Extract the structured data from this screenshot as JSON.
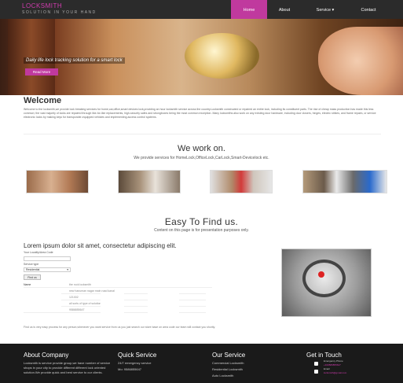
{
  "header": {
    "logo": "LOCKSMITH",
    "tagline": "SOLUTION IN YOUR HAND",
    "menu": [
      "Home",
      "About",
      "Service ▾",
      "Contact"
    ]
  },
  "hero": {
    "caption": "Daily life lock tracking solution for a smart lock",
    "button": "Read More"
  },
  "welcome": {
    "title": "Welcome",
    "text": "Welcome to the locksmith,we provide lock breaking services for home,car,office,smart devices lock,providing an hour locksmith service across the country.Locksmith constructed or repaired an entire lock, including its constituent parts. The rise of cheap mass production has made this less common; the vast majority of locks are repaired through like-for-like replacements, high-security safes and strongboxes being the most common exception. Many locksmiths also work on any existing door hardware, including door closers, hinges, electric strikes, and frame repairs, or service electronic locks by making keys for transponder-equipped vehicles and implementing access control systems."
  },
  "work": {
    "title": "We work on.",
    "subtitle": "We provide services for HomeLock,OfficeLock,CarLock,Smart-Devicelock etc."
  },
  "find": {
    "title": "Easy To Find us.",
    "subtitle": "Content on this page is for presentation purposes only.",
    "heading": "Lorem ipsum dolor sit amet, consectetur adipiscing elit.",
    "area_label": "Your Locality/Area Code",
    "service_label": "Service type",
    "service_value": "Residential",
    "find_button": "Find us",
    "table": [
      {
        "k": "Name",
        "v": "the rock locksmith"
      },
      {
        "k": "Address",
        "v": "new hanuman nagar main road kanal"
      },
      {
        "k": "Pin",
        "v": "121002"
      },
      {
        "k": "Service",
        "v": "all sorts of type of solution about lock"
      },
      {
        "k": "Contact",
        "v": "9586855647"
      }
    ],
    "note": "Find us is very easy process for any person,whenever you want service from us you just search our store base on area code our team will contact you shortly."
  },
  "footer": {
    "about_title": "About Company",
    "about_text": "Locksmith is service provide group,we have number of service shops in your city to provide different different lock oriented solution.We provide quick and best service to our clients.",
    "quick_title": "Quick Service",
    "quick_1": "24/7 emergency service",
    "quick_2": "Mo: 9586855647",
    "service_title": "Our Service",
    "service_1": "Commercial Locksmith",
    "service_2": "Residential Locksmith",
    "service_3": "Auto Locksmith",
    "touch_title": "Get in Touch",
    "phone_label": "Emergency Phone",
    "phone": "+919586855647",
    "email_label": "Email",
    "email": "locksmith@gmail.com"
  }
}
